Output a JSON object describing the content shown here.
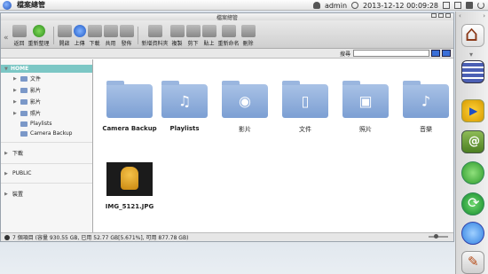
{
  "system": {
    "title": "檔案總管",
    "user": "admin",
    "datetime": "2013-12-12 00:09:28"
  },
  "window": {
    "title": "檔案總管"
  },
  "toolbar": {
    "buttons": [
      {
        "label": "返回"
      },
      {
        "label": "重新整理"
      },
      {
        "label": "開啟"
      },
      {
        "label": "上傳"
      },
      {
        "label": "下載"
      },
      {
        "label": "共用"
      },
      {
        "label": "發佈"
      },
      {
        "label": "新增資料夾"
      },
      {
        "label": "複製"
      },
      {
        "label": "剪下"
      },
      {
        "label": "貼上"
      },
      {
        "label": "重新命名"
      },
      {
        "label": "刪除"
      }
    ]
  },
  "search": {
    "label": "搜尋",
    "value": "",
    "placeholder": ""
  },
  "sidebar": {
    "root": "HOME",
    "items": [
      "文件",
      "影片",
      "影片",
      "照片",
      "Playlists",
      "Camera Backup"
    ],
    "groups": [
      "下載",
      "PUBLIC",
      "裝置"
    ]
  },
  "main": {
    "folders": [
      {
        "label": "Camera Backup",
        "icon": "camera-icon",
        "glyph": ""
      },
      {
        "label": "Playlists",
        "icon": "playlist-icon",
        "glyph": "♫"
      },
      {
        "label": "影片",
        "icon": "film-reel-icon",
        "glyph": "◉"
      },
      {
        "label": "文件",
        "icon": "document-icon",
        "glyph": "▯"
      },
      {
        "label": "照片",
        "icon": "picture-icon",
        "glyph": "▣"
      },
      {
        "label": "音樂",
        "icon": "music-note-icon",
        "glyph": "♪"
      }
    ],
    "file": {
      "label": "IMG_5121.JPG"
    }
  },
  "status": {
    "text": "7 個項目 (容量 930.55 GB, 已用 52.77 GB[5.671%], 可用 877.78 GB)"
  },
  "dock": {
    "arrow_left": "‹",
    "arrow_right": "›",
    "arrow_down": "▾"
  }
}
